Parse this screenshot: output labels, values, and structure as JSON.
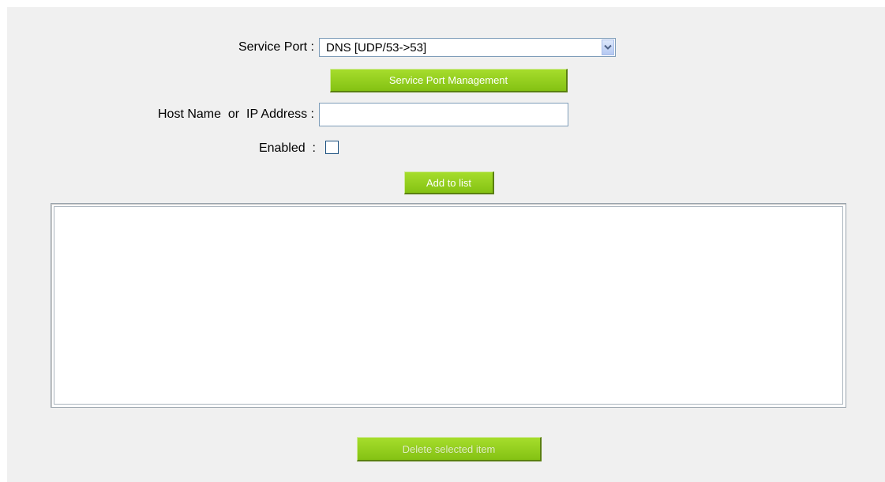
{
  "form": {
    "service_port_label": "Service Port :",
    "service_port_value": "DNS [UDP/53->53]",
    "service_port_management_button": "Service Port Management",
    "host_label": "Host Name  or  IP Address :",
    "host_value": "",
    "enabled_label": "Enabled  :",
    "enabled_checked": false,
    "add_button": "Add to list"
  },
  "list": {
    "items": []
  },
  "footer": {
    "delete_button": "Delete selected item"
  },
  "colors": {
    "panel_bg": "#f0f0f0",
    "button_green": "#95cf1f",
    "input_border": "#7f9db9"
  },
  "icons": {
    "dropdown": "chevron-down-icon"
  }
}
